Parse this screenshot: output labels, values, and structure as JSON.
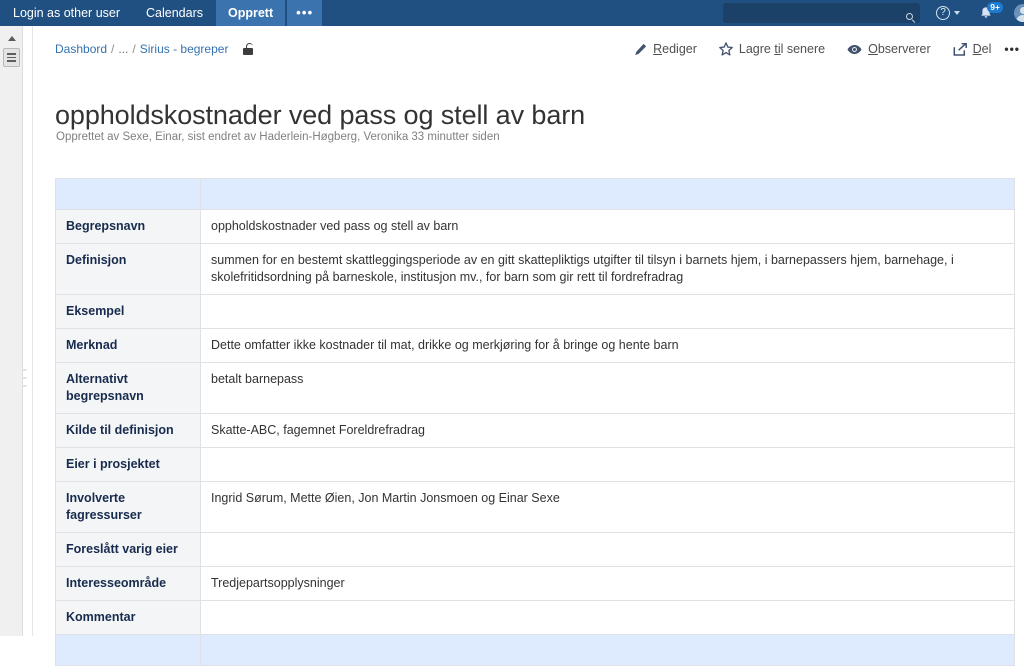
{
  "nav": {
    "items": [
      {
        "label": "Login as other user",
        "name": "nav-login-as-other-user",
        "style": "plain"
      },
      {
        "label": "Calendars",
        "name": "nav-calendars",
        "style": "plain"
      },
      {
        "label": "Opprett",
        "name": "nav-create-button",
        "style": "create"
      },
      {
        "label": "•••",
        "name": "nav-more-button",
        "style": "ellipsis"
      }
    ],
    "login_as_other_user": "Login as other user",
    "calendars": "Calendars",
    "create": "Opprett",
    "more": "•••",
    "search_placeholder": "",
    "search_value": "",
    "notification_badge": "9+",
    "help_glyph": "?",
    "background_color": "#205081",
    "create_background_color": "#3b73af"
  },
  "sidebar": {
    "collapse_icon": "chevron-up-icon",
    "menu_icon": "sidebar-list-icon",
    "resize_handle": "sidebar-resize-grip"
  },
  "breadcrumb": {
    "items": [
      {
        "label": "Dashbord",
        "link": true
      },
      {
        "label": "...",
        "link": false
      },
      {
        "label": "Sirius - begreper",
        "link": true
      }
    ],
    "dashboard": "Dashbord",
    "ellipsis": "...",
    "space": "Sirius - begreper",
    "separator": "/",
    "restriction_icon": "unlocked-padlock-icon"
  },
  "actions": {
    "edit": {
      "label": "Rediger",
      "accesskey_prefix": "",
      "accesskey": "R",
      "accesskey_suffix": "ediger",
      "icon": "pencil-icon"
    },
    "save_for_later": {
      "label": "Lagre til senere",
      "accesskey_prefix": "Lagre ",
      "accesskey": "ti",
      "accesskey_suffix": "l senere",
      "icon": "star-icon"
    },
    "watch": {
      "label": "Observerer",
      "accesskey_prefix": "",
      "accesskey": "O",
      "accesskey_suffix": "bserverer",
      "icon": "eye-icon"
    },
    "share": {
      "label": "Del",
      "accesskey_prefix": "",
      "accesskey": "D",
      "accesskey_suffix": "el",
      "icon": "share-icon"
    },
    "more": {
      "label": "•••",
      "icon": "ellipsis-icon"
    }
  },
  "page": {
    "title": "oppholdskostnader ved pass og stell av barn",
    "meta": "Opprettet av Sexe, Einar, sist endret av Haderlein-Høgberg, Veronika 33 minutter siden"
  },
  "table": {
    "header_row": {
      "label": "",
      "value": ""
    },
    "footer_row": {
      "label": "",
      "value": ""
    },
    "rows": [
      {
        "label": "Begrepsnavn",
        "value": "oppholdskostnader ved pass og stell av barn"
      },
      {
        "label": "Definisjon",
        "value": "summen for en bestemt skattleggingsperiode av en gitt skattepliktigs utgifter til tilsyn i barnets hjem, i barnepassers hjem, barnehage, i skolefritidsordning på barneskole, institusjon mv., for barn som gir rett til fordrefradrag"
      },
      {
        "label": "Eksempel",
        "value": ""
      },
      {
        "label": "Merknad",
        "value": "Dette omfatter ikke kostnader til mat, drikke og merkjøring for å bringe og hente barn"
      },
      {
        "label": "Alternativt begrepsnavn",
        "value": "betalt barnepass"
      },
      {
        "label": "Kilde til definisjon",
        "value": "Skatte-ABC, fagemnet Foreldrefradrag"
      },
      {
        "label": "Eier i prosjektet",
        "value": ""
      },
      {
        "label": "Involverte fagressurser",
        "value": "Ingrid Sørum, Mette Øien, Jon Martin Jonsmoen og Einar Sexe"
      },
      {
        "label": "Foreslått varig eier",
        "value": ""
      },
      {
        "label": "Interesseområde",
        "value": "Tredjepartsopplysninger"
      },
      {
        "label": "Kommentar",
        "value": ""
      }
    ],
    "band_color": "#deebff",
    "label_color": "#f4f5f7",
    "border_color": "#dfe1e6"
  }
}
